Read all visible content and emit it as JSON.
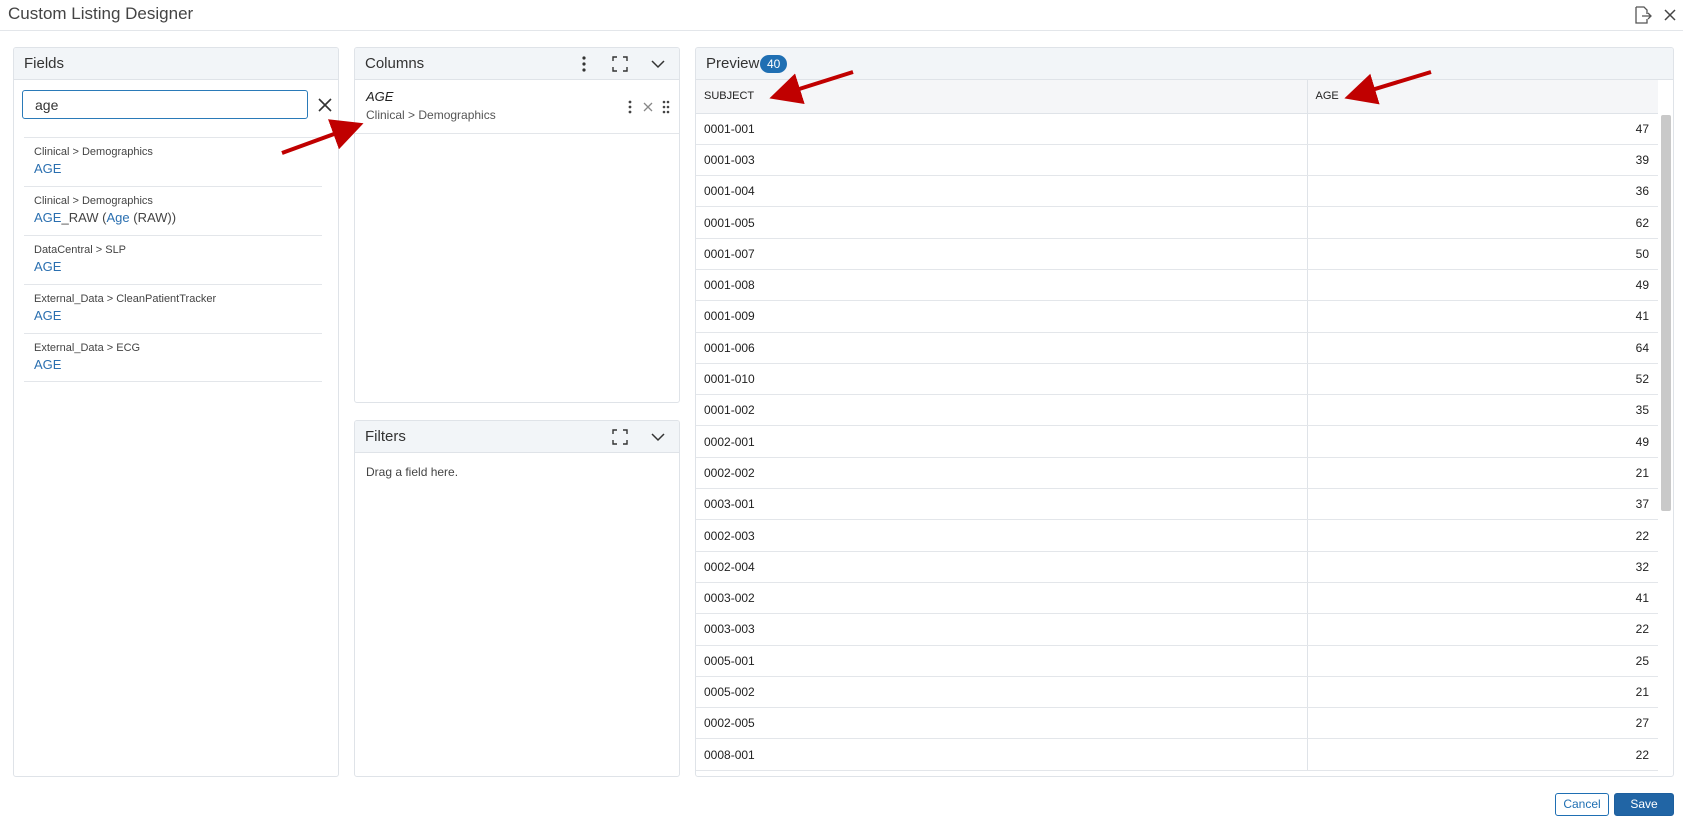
{
  "window": {
    "title": "Custom Listing Designer"
  },
  "fields": {
    "title": "Fields",
    "search_value": "age",
    "items": [
      {
        "path": "Clinical > Demographics",
        "name": "AGE"
      },
      {
        "path": "Clinical > Demographics",
        "name_prefix": "AGE",
        "name_suffix": "_RAW (",
        "name_link": "Age",
        "name_tail": " (RAW))"
      },
      {
        "path": "DataCentral > SLP",
        "name": "AGE"
      },
      {
        "path": "External_Data > CleanPatientTracker",
        "name": "AGE"
      },
      {
        "path": "External_Data > ECG",
        "name": "AGE"
      }
    ]
  },
  "columns": {
    "title": "Columns",
    "items": [
      {
        "name": "AGE",
        "path": "Clinical > Demographics"
      }
    ]
  },
  "filters": {
    "title": "Filters",
    "hint": "Drag a field here."
  },
  "preview": {
    "title": "Preview",
    "count": "40",
    "headers": [
      "SUBJECT",
      "AGE"
    ],
    "rows": [
      [
        "0001-001",
        "47"
      ],
      [
        "0001-003",
        "39"
      ],
      [
        "0001-004",
        "36"
      ],
      [
        "0001-005",
        "62"
      ],
      [
        "0001-007",
        "50"
      ],
      [
        "0001-008",
        "49"
      ],
      [
        "0001-009",
        "41"
      ],
      [
        "0001-006",
        "64"
      ],
      [
        "0001-010",
        "52"
      ],
      [
        "0001-002",
        "35"
      ],
      [
        "0002-001",
        "49"
      ],
      [
        "0002-002",
        "21"
      ],
      [
        "0003-001",
        "37"
      ],
      [
        "0002-003",
        "22"
      ],
      [
        "0002-004",
        "32"
      ],
      [
        "0003-002",
        "41"
      ],
      [
        "0003-003",
        "22"
      ],
      [
        "0005-001",
        "25"
      ],
      [
        "0005-002",
        "21"
      ],
      [
        "0002-005",
        "27"
      ],
      [
        "0008-001",
        "22"
      ]
    ]
  },
  "footer": {
    "cancel_label": "Cancel",
    "save_label": "Save"
  },
  "colors": {
    "accent": "#1f6fb3",
    "link": "#2a6fb0",
    "arrow": "#c00000",
    "panel_header": "#f2f5f8"
  }
}
